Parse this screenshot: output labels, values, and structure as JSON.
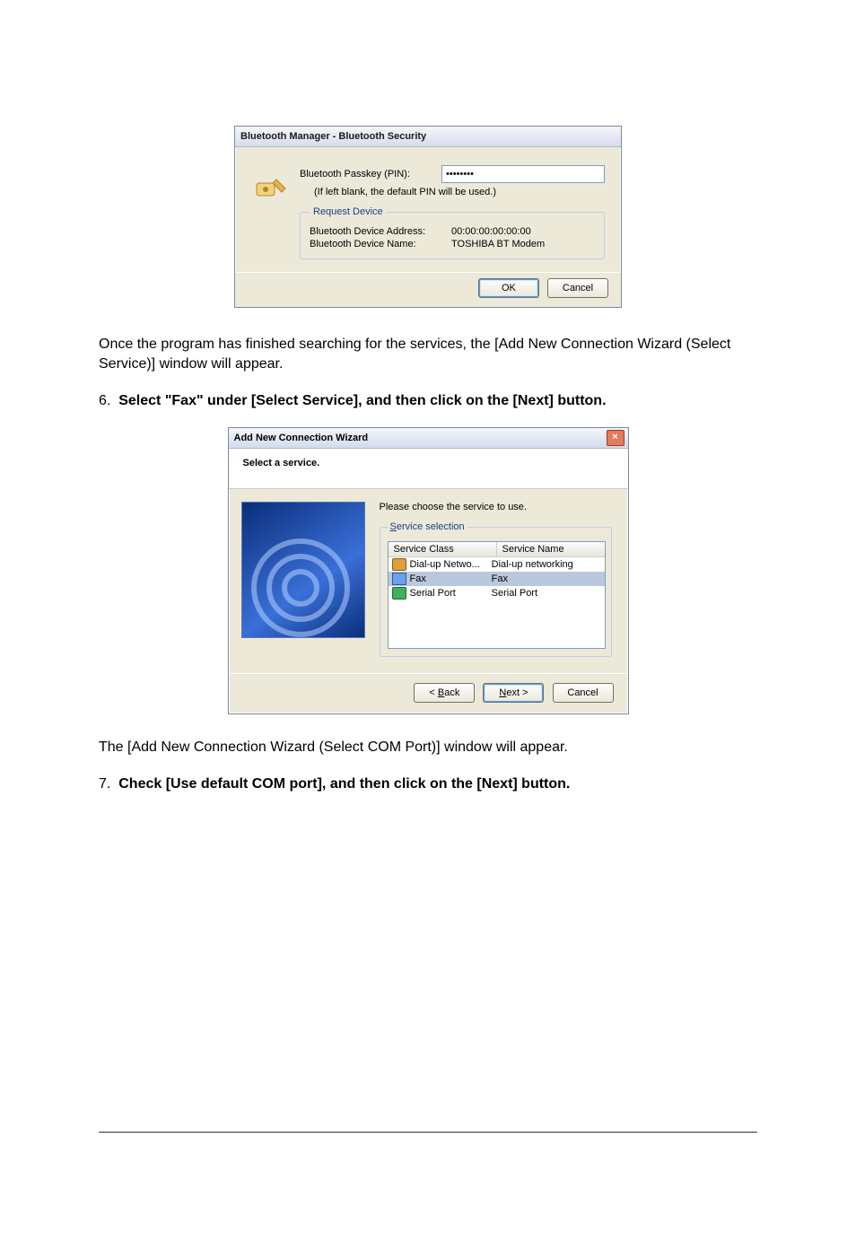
{
  "dialog1": {
    "title": "Bluetooth Manager - Bluetooth Security",
    "pin_label": "Bluetooth Passkey (PIN):",
    "pin_value": "••••••••",
    "pin_hint": "(If left blank, the default PIN will be used.)",
    "fieldset_legend": "Request Device",
    "addr_label": "Bluetooth Device Address:",
    "addr_value": "00:00:00:00:00:00",
    "name_label": "Bluetooth Device Name:",
    "name_value": "TOSHIBA BT Modem",
    "ok": "OK",
    "cancel": "Cancel"
  },
  "para1": "Once the program has finished searching for the services, the [Add New Connection Wizard (Select Service)] window will appear.",
  "step6_num": "6.",
  "step6": "Select \"Fax\" under [Select Service], and then click on the [Next] button.",
  "dialog2": {
    "title": "Add New Connection Wizard",
    "head": "Select a service.",
    "choose": "Please choose the service to use.",
    "legend": "Service selection",
    "col_class": "Service Class",
    "col_name": "Service Name",
    "rows": [
      {
        "cls": "Dial-up Netwo...",
        "name": "Dial-up networking"
      },
      {
        "cls": "Fax",
        "name": "Fax"
      },
      {
        "cls": "Serial Port",
        "name": "Serial Port"
      }
    ],
    "back": "< Back",
    "next": "Next >",
    "cancel": "Cancel"
  },
  "para2": "The [Add New Connection Wizard (Select COM Port)] window will appear.",
  "step7_num": "7.",
  "step7": "Check [Use default COM port], and then click on the [Next] button."
}
